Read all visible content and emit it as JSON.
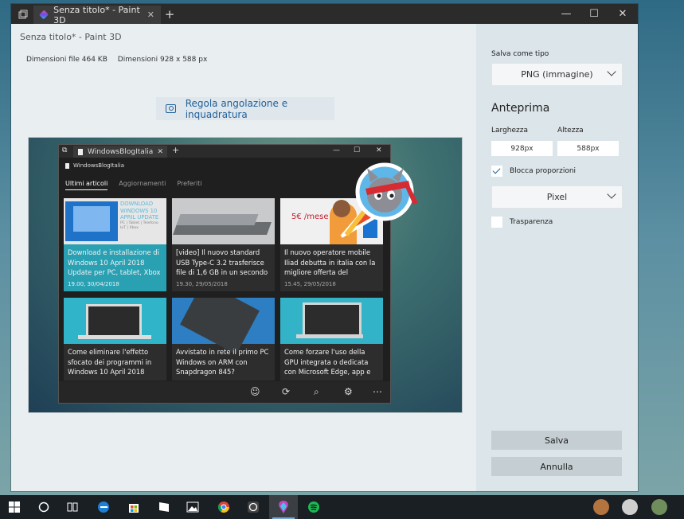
{
  "window": {
    "tab_title": "Senza titolo* - Paint 3D",
    "new_tab": "+",
    "minimize": "—",
    "maximize": "☐",
    "close": "✕"
  },
  "main": {
    "app_title": "Senza titolo* - Paint 3D",
    "file_size": "Dimensioni file  464 KB",
    "dimensions": "Dimensioni  928 x 588 px",
    "adjust_button": "Regola angolazione e inquadratura"
  },
  "preview": {
    "browser_tab": "WindowsBlogItalia",
    "site_name": "WindowsBlogItalia",
    "nav": [
      "Ultimi articoli",
      "Aggiornamenti",
      "Preferiti"
    ],
    "articles": [
      {
        "title": "Download e installazione di Windows 10 April 2018 Update per PC, tablet, Xbox",
        "date": "19.00, 30/04/2018",
        "thumb_text": "DOWNLOAD WINDOWS 10 APRIL UPDATE",
        "thumb_sub": "PC | Tablet | Telefono IoT | Xbox"
      },
      {
        "title": "[video] Il nuovo standard USB Type-C 3.2 trasferisce file di 1,6 GB in un secondo",
        "date": "19.30, 29/05/2018"
      },
      {
        "title": "Il nuovo operatore mobile Iliad debutta in italia con la migliore offerta del",
        "date": "15.45, 29/05/2018",
        "thumb_text": "5€ /mese"
      },
      {
        "title": "Come eliminare l'effetto sfocato dei programmi in Windows 10 April 2018",
        "date": ""
      },
      {
        "title": "Avvistato in rete il primo PC Windows on ARM con Snapdragon 845?",
        "date": ""
      },
      {
        "title": "Come forzare l'uso della GPU integrata o dedicata con Microsoft Edge, app e",
        "date": ""
      }
    ]
  },
  "side": {
    "save_type_label": "Salva come tipo",
    "save_type_value": "PNG (immagine)",
    "preview_heading": "Anteprima",
    "width_label": "Larghezza",
    "height_label": "Altezza",
    "width_value": "928px",
    "height_value": "588px",
    "lock_label": "Blocca proporzioni",
    "lock_checked": true,
    "unit_value": "Pixel",
    "transparency_label": "Trasparenza",
    "transparency_checked": false,
    "save_button": "Salva",
    "cancel_button": "Annulla"
  },
  "taskbar": {
    "icons": [
      "windows-start-icon",
      "cortana-icon",
      "task-view-icon",
      "edge-icon",
      "store-icon",
      "windowsblogitalia-icon",
      "photos-icon",
      "chrome-icon",
      "whatsapp-icon",
      "paint3d-icon",
      "spotify-icon"
    ]
  },
  "colors": {
    "titlebar": "#2b2b2b",
    "accent": "#1f5f9a",
    "teal_card": "#2aa0b3",
    "side_panel": "#dce5ea"
  }
}
